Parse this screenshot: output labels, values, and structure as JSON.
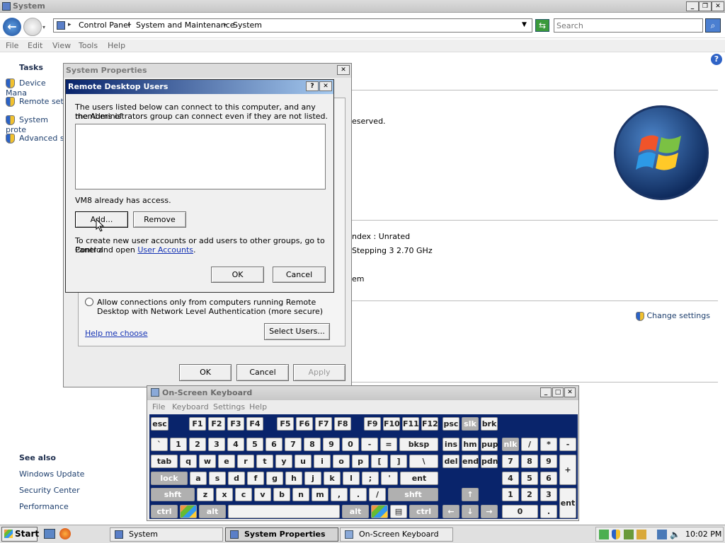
{
  "window": {
    "title": "System"
  },
  "nav": {
    "breadcrumb": [
      "Control Panel",
      "System and Maintenance",
      "System"
    ],
    "search_placeholder": "Search"
  },
  "menu": [
    "File",
    "Edit",
    "View",
    "Tools",
    "Help"
  ],
  "tasks": {
    "heading": "Tasks",
    "items": [
      "Device Mana",
      "Remote setti",
      "System prote",
      "Advanced sy"
    ]
  },
  "see_also": {
    "heading": "See also",
    "items": [
      "Windows Update",
      "Security Center",
      "Performance"
    ]
  },
  "main": {
    "reserved_text": "eserved.",
    "index_text": "ndex : Unrated",
    "stepping_text": "Stepping 3   2.70 GHz",
    "em_text": "em",
    "change_settings": "Change settings"
  },
  "sysprops": {
    "title": "System Properties",
    "radio_label_line1": "Allow connections only from computers running Remote",
    "radio_label_line2": "Desktop with Network Level Authentication (more secure)",
    "help_link": "Help me choose",
    "select_users": "Select Users...",
    "ok": "OK",
    "cancel": "Cancel",
    "apply": "Apply"
  },
  "rdu": {
    "title": "Remote Desktop Users",
    "help_btn": "?",
    "desc_line1": "The users listed below can connect to this computer, and any members of",
    "desc_line2": "the Administrators group can connect even if they are not listed.",
    "access_text": "VM8 already has access.",
    "add": "Add...",
    "remove": "Remove",
    "info_line1": "To create new user accounts or add users to other groups, go to Control",
    "info_line2_prefix": "Panel and open ",
    "info_link": "User Accounts",
    "info_suffix": ".",
    "ok": "OK",
    "cancel": "Cancel"
  },
  "osk": {
    "title": "On-Screen Keyboard",
    "menu": [
      "File",
      "Keyboard",
      "Settings",
      "Help"
    ],
    "row1": [
      "esc",
      "F1",
      "F2",
      "F3",
      "F4",
      "F5",
      "F6",
      "F7",
      "F8",
      "F9",
      "F10",
      "F11",
      "F12",
      "psc",
      "slk",
      "brk"
    ],
    "row2": [
      "`",
      "1",
      "2",
      "3",
      "4",
      "5",
      "6",
      "7",
      "8",
      "9",
      "0",
      "-",
      "=",
      "bksp",
      "ins",
      "hm",
      "pup",
      "nlk",
      "/",
      "*",
      "-"
    ],
    "row3": [
      "tab",
      "q",
      "w",
      "e",
      "r",
      "t",
      "y",
      "u",
      "i",
      "o",
      "p",
      "[",
      "]",
      "\\",
      "del",
      "end",
      "pdn",
      "7",
      "8",
      "9",
      "+"
    ],
    "row4": [
      "lock",
      "a",
      "s",
      "d",
      "f",
      "g",
      "h",
      "j",
      "k",
      "l",
      ";",
      "'",
      "ent",
      "4",
      "5",
      "6"
    ],
    "row5": [
      "shft",
      "z",
      "x",
      "c",
      "v",
      "b",
      "n",
      "m",
      ",",
      ".",
      "/",
      "shft",
      "1",
      "2",
      "3",
      "ent"
    ],
    "row6": [
      "ctrl",
      "alt",
      "alt",
      "ctrl",
      "0",
      "."
    ]
  },
  "taskbar": {
    "start": "Start",
    "items": [
      "System",
      "System Properties",
      "On-Screen Keyboard"
    ],
    "time": "10:02 PM"
  }
}
